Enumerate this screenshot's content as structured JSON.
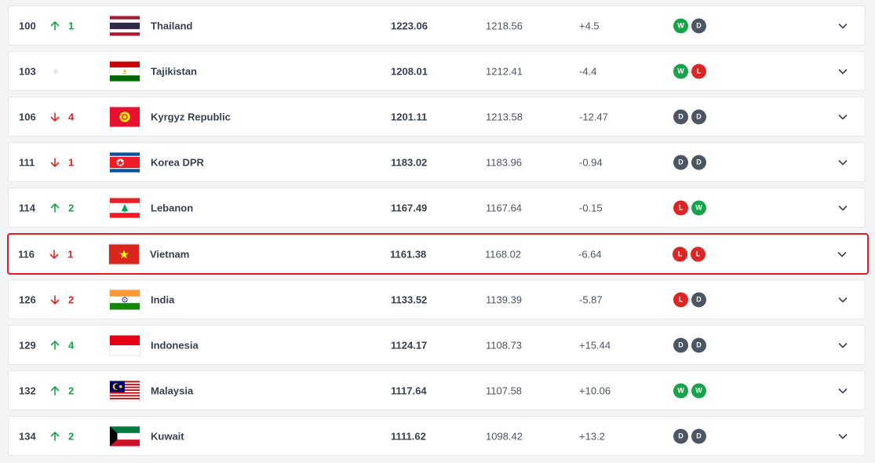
{
  "colors": {
    "up": "#16a34a",
    "down": "#dc2626",
    "win": "#16a34a",
    "loss": "#dc2626",
    "draw": "#4b5563",
    "highlight_border": "#e31b23"
  },
  "rows": [
    {
      "rank": "100",
      "movement": "up",
      "change": "1",
      "flag": "thailand-flag",
      "country": "Thailand",
      "points": "1223.06",
      "previous_points": "1218.56",
      "difference": "+4.5",
      "form": [
        "W",
        "D"
      ],
      "highlighted": false
    },
    {
      "rank": "103",
      "movement": "none",
      "change": "",
      "flag": "tajikistan-flag",
      "country": "Tajikistan",
      "points": "1208.01",
      "previous_points": "1212.41",
      "difference": "-4.4",
      "form": [
        "W",
        "L"
      ],
      "highlighted": false
    },
    {
      "rank": "106",
      "movement": "down",
      "change": "4",
      "flag": "kyrgyz-republic-flag",
      "country": "Kyrgyz Republic",
      "points": "1201.11",
      "previous_points": "1213.58",
      "difference": "-12.47",
      "form": [
        "D",
        "D"
      ],
      "highlighted": false
    },
    {
      "rank": "111",
      "movement": "down",
      "change": "1",
      "flag": "korea-dpr-flag",
      "country": "Korea DPR",
      "points": "1183.02",
      "previous_points": "1183.96",
      "difference": "-0.94",
      "form": [
        "D",
        "D"
      ],
      "highlighted": false
    },
    {
      "rank": "114",
      "movement": "up",
      "change": "2",
      "flag": "lebanon-flag",
      "country": "Lebanon",
      "points": "1167.49",
      "previous_points": "1167.64",
      "difference": "-0.15",
      "form": [
        "L",
        "W"
      ],
      "highlighted": false
    },
    {
      "rank": "116",
      "movement": "down",
      "change": "1",
      "flag": "vietnam-flag",
      "country": "Vietnam",
      "points": "1161.38",
      "previous_points": "1168.02",
      "difference": "-6.64",
      "form": [
        "L",
        "L"
      ],
      "highlighted": true
    },
    {
      "rank": "126",
      "movement": "down",
      "change": "2",
      "flag": "india-flag",
      "country": "India",
      "points": "1133.52",
      "previous_points": "1139.39",
      "difference": "-5.87",
      "form": [
        "L",
        "D"
      ],
      "highlighted": false
    },
    {
      "rank": "129",
      "movement": "up",
      "change": "4",
      "flag": "indonesia-flag",
      "country": "Indonesia",
      "points": "1124.17",
      "previous_points": "1108.73",
      "difference": "+15.44",
      "form": [
        "D",
        "D"
      ],
      "highlighted": false
    },
    {
      "rank": "132",
      "movement": "up",
      "change": "2",
      "flag": "malaysia-flag",
      "country": "Malaysia",
      "points": "1117.64",
      "previous_points": "1107.58",
      "difference": "+10.06",
      "form": [
        "W",
        "W"
      ],
      "highlighted": false
    },
    {
      "rank": "134",
      "movement": "up",
      "change": "2",
      "flag": "kuwait-flag",
      "country": "Kuwait",
      "points": "1111.62",
      "previous_points": "1098.42",
      "difference": "+13.2",
      "form": [
        "D",
        "D"
      ],
      "highlighted": false
    }
  ]
}
